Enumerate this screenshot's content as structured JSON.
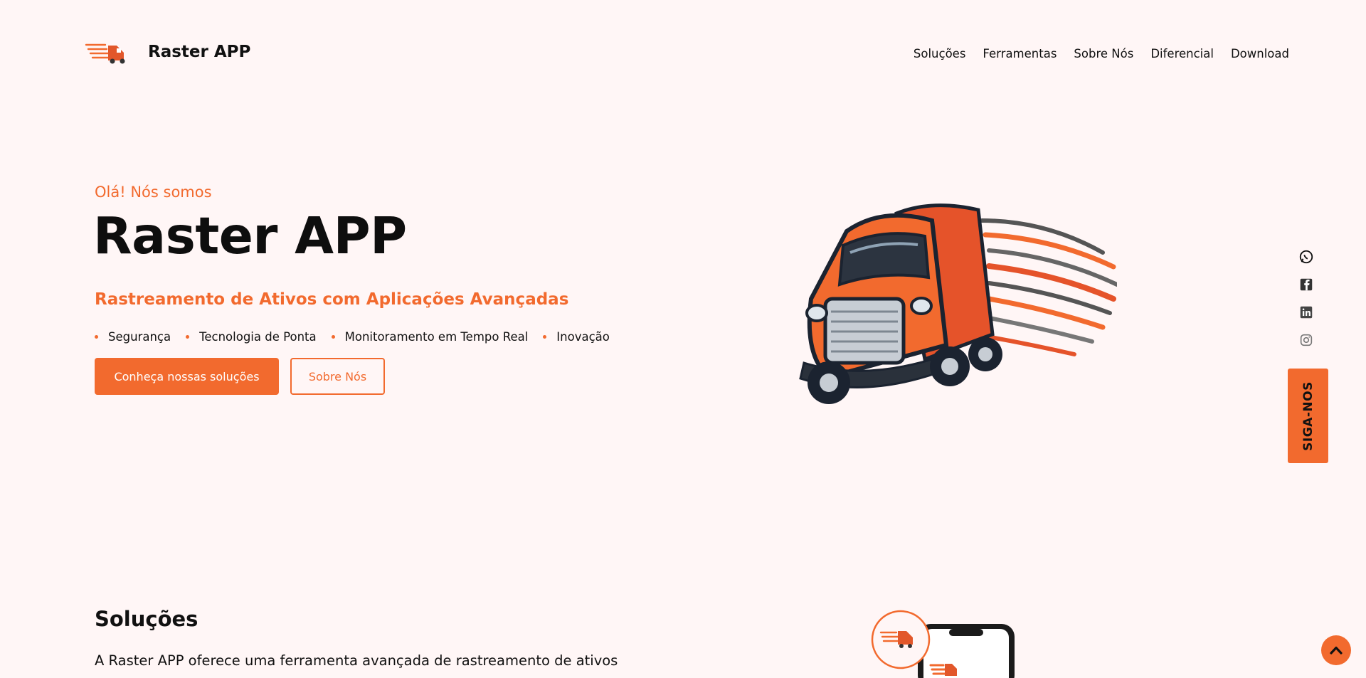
{
  "header": {
    "brand": "Raster APP",
    "logo_text": "Raster App",
    "nav": [
      "Soluções",
      "Ferramentas",
      "Sobre Nós",
      "Diferencial",
      "Download"
    ]
  },
  "hero": {
    "eyebrow": "Olá! Nós somos",
    "title": "Raster APP",
    "subtitle": "Rastreamento de Ativos com Aplicações Avançadas",
    "bullets": [
      "Segurança",
      "Tecnologia de Ponta",
      "Monitoramento em Tempo Real",
      "Inovação"
    ],
    "primary_button": "Conheça nossas soluções",
    "secondary_button": "Sobre Nós"
  },
  "social": {
    "icons": [
      "whatsapp-icon",
      "facebook-icon",
      "linkedin-icon",
      "instagram-icon"
    ],
    "follow_label": "SIGA-NOS"
  },
  "solutions": {
    "title": "Soluções",
    "text": "A Raster APP oferece uma ferramenta avançada de rastreamento de ativos"
  },
  "colors": {
    "accent": "#f26a2e",
    "background": "#fff6f6",
    "text": "#111111"
  }
}
